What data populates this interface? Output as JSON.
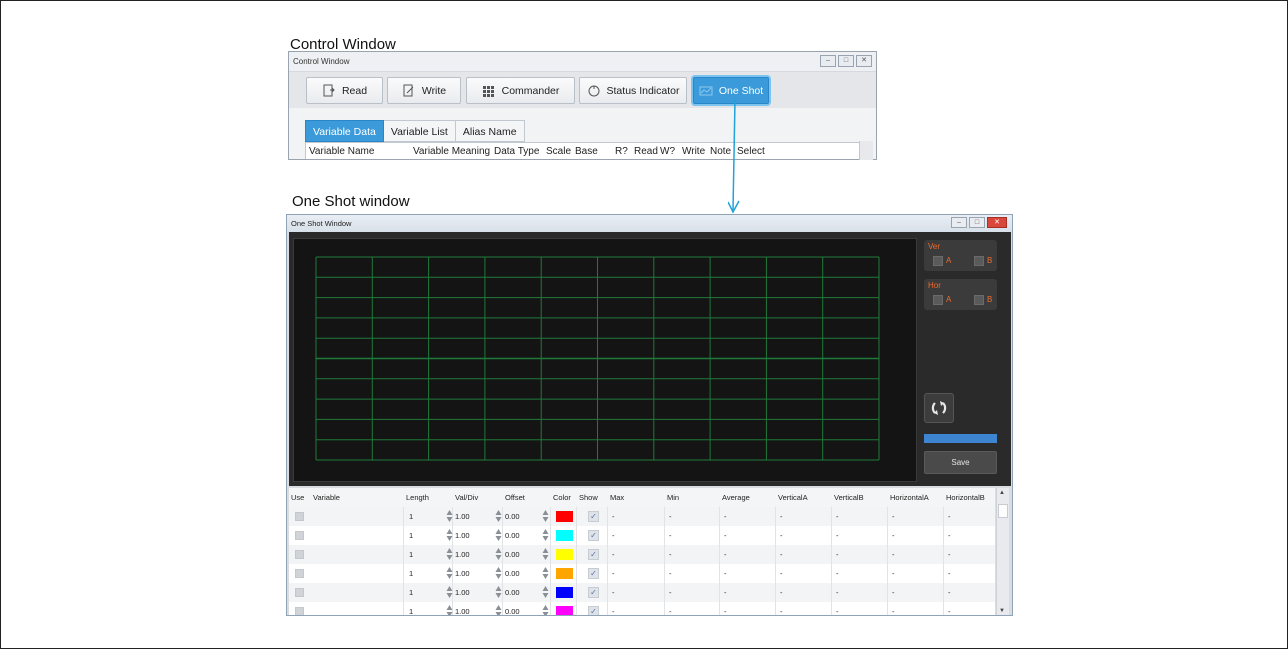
{
  "captions": {
    "control": "Control Window",
    "oneshot": "One Shot window"
  },
  "control_window": {
    "title": "Control Window",
    "toolbar": [
      {
        "label": "Read",
        "icon": "read-icon",
        "active": false
      },
      {
        "label": "Write",
        "icon": "write-icon",
        "active": false
      },
      {
        "label": "Commander",
        "icon": "commander-icon",
        "active": false
      },
      {
        "label": "Status Indicator",
        "icon": "status-indicator-icon",
        "active": false
      },
      {
        "label": "One Shot",
        "icon": "one-shot-icon",
        "active": true
      }
    ],
    "tabs": [
      {
        "label": "Variable Data",
        "active": true
      },
      {
        "label": "Variable List",
        "active": false
      },
      {
        "label": "Alias Name",
        "active": false
      }
    ],
    "columns": [
      "Variable Name",
      "Variable Meaning",
      "Data Type",
      "Scale",
      "Base",
      "R?",
      "Read",
      "W?",
      "Write",
      "Note",
      "Select"
    ]
  },
  "oneshot_window": {
    "title": "One Shot Window",
    "ver": {
      "label": "Ver",
      "a": "A",
      "b": "B"
    },
    "hor": {
      "label": "Hor",
      "a": "A",
      "b": "B"
    },
    "save_label": "Save",
    "progress": 1.0,
    "grid_color": "#1f7a3a",
    "columns": [
      "Use",
      "Variable",
      "Length",
      "Val/Div",
      "Offset",
      "Color",
      "Show",
      "Max",
      "Min",
      "Average",
      "VerticalA",
      "VerticalB",
      "HorizontalA",
      "HorizontalB"
    ],
    "rows": [
      {
        "length": "1",
        "valdiv": "1.00",
        "offset": "0.00",
        "color": "#ff0000",
        "max": "-",
        "min": "-",
        "average": "-",
        "va": "-",
        "vb": "-",
        "ha": "-",
        "hb": "-"
      },
      {
        "length": "1",
        "valdiv": "1.00",
        "offset": "0.00",
        "color": "#00ffff",
        "max": "-",
        "min": "-",
        "average": "-",
        "va": "-",
        "vb": "-",
        "ha": "-",
        "hb": "-"
      },
      {
        "length": "1",
        "valdiv": "1.00",
        "offset": "0.00",
        "color": "#ffff00",
        "max": "-",
        "min": "-",
        "average": "-",
        "va": "-",
        "vb": "-",
        "ha": "-",
        "hb": "-"
      },
      {
        "length": "1",
        "valdiv": "1.00",
        "offset": "0.00",
        "color": "#ffa500",
        "max": "-",
        "min": "-",
        "average": "-",
        "va": "-",
        "vb": "-",
        "ha": "-",
        "hb": "-"
      },
      {
        "length": "1",
        "valdiv": "1.00",
        "offset": "0.00",
        "color": "#0000ff",
        "max": "-",
        "min": "-",
        "average": "-",
        "va": "-",
        "vb": "-",
        "ha": "-",
        "hb": "-"
      },
      {
        "length": "1",
        "valdiv": "1.00",
        "offset": "0.00",
        "color": "#ff00ff",
        "max": "-",
        "min": "-",
        "average": "-",
        "va": "-",
        "vb": "-",
        "ha": "-",
        "hb": "-"
      }
    ]
  },
  "colors": {
    "accent": "#3b9ad9",
    "orange_label": "#f06b2c",
    "arrow": "#1fa3d8"
  }
}
